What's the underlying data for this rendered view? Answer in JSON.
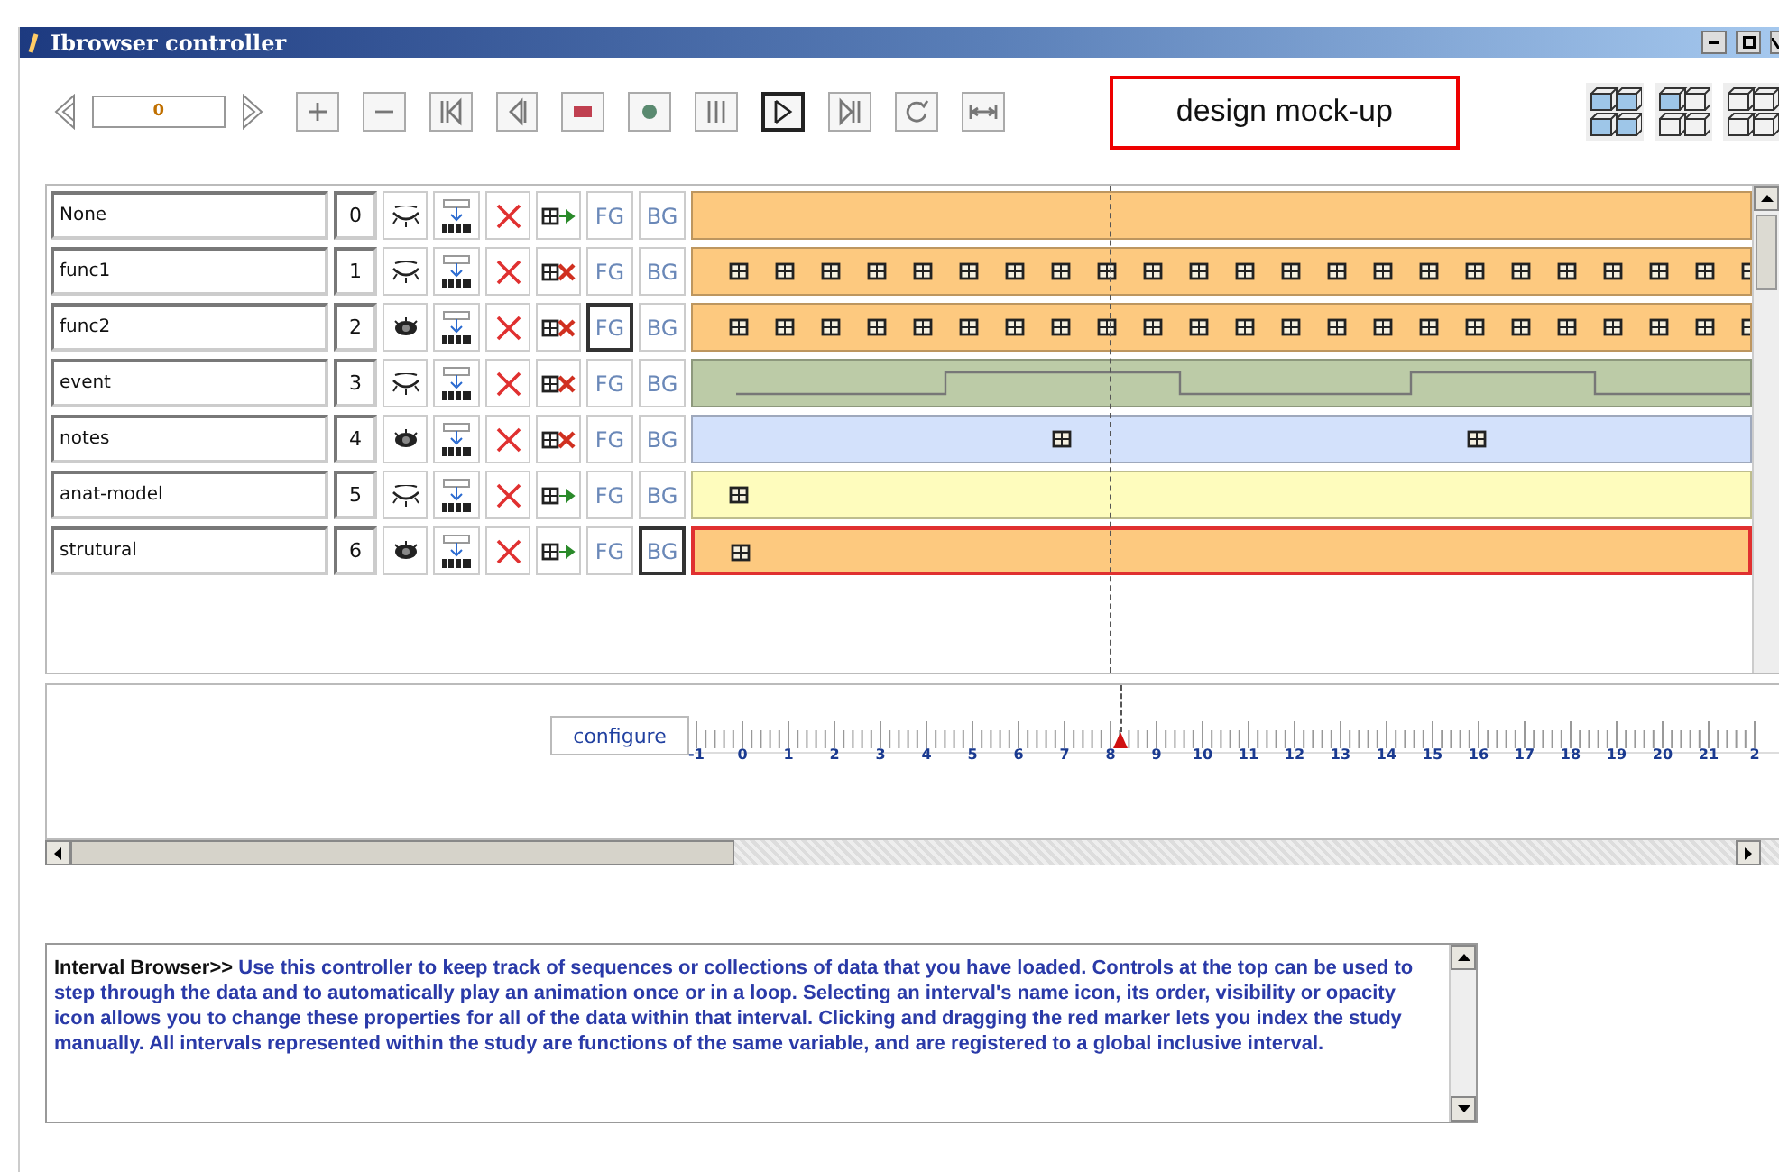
{
  "window": {
    "title": "Ibrowser controller"
  },
  "toolbar": {
    "frame_value": "0",
    "buttons": [
      {
        "kind": "add",
        "selected": false
      },
      {
        "kind": "remove",
        "selected": false
      },
      {
        "kind": "first",
        "selected": false
      },
      {
        "kind": "back",
        "selected": false
      },
      {
        "kind": "stop",
        "selected": false
      },
      {
        "kind": "record",
        "selected": false
      },
      {
        "kind": "pause",
        "selected": false
      },
      {
        "kind": "play",
        "selected": true
      },
      {
        "kind": "last",
        "selected": false
      },
      {
        "kind": "loop",
        "selected": false
      },
      {
        "kind": "fit",
        "selected": false
      }
    ],
    "note": "design mock-up"
  },
  "intervals": [
    {
      "name": "None",
      "order": "0",
      "visible": false,
      "linked": true,
      "fg": "FG",
      "bg": "BG",
      "fg_selected": false,
      "bg_selected": false,
      "color": "#fdc97f",
      "selected": false,
      "kind": "empty"
    },
    {
      "name": "func1",
      "order": "1",
      "visible": false,
      "linked": false,
      "fg": "FG",
      "bg": "BG",
      "fg_selected": false,
      "bg_selected": false,
      "color": "#fdc97f",
      "selected": false,
      "kind": "dense"
    },
    {
      "name": "func2",
      "order": "2",
      "visible": true,
      "linked": false,
      "fg": "FG",
      "bg": "BG",
      "fg_selected": true,
      "bg_selected": false,
      "color": "#fdc97f",
      "selected": false,
      "kind": "dense"
    },
    {
      "name": "event",
      "order": "3",
      "visible": false,
      "linked": false,
      "fg": "FG",
      "bg": "BG",
      "fg_selected": false,
      "bg_selected": false,
      "color": "#bccba7",
      "selected": false,
      "kind": "wave"
    },
    {
      "name": "notes",
      "order": "4",
      "visible": true,
      "linked": false,
      "fg": "FG",
      "bg": "BG",
      "fg_selected": false,
      "bg_selected": false,
      "color": "#d3e1fb",
      "selected": false,
      "kind": "sparse"
    },
    {
      "name": "anat-model",
      "order": "5",
      "visible": false,
      "linked": true,
      "fg": "FG",
      "bg": "BG",
      "fg_selected": false,
      "bg_selected": false,
      "color": "#fefcbd",
      "selected": false,
      "kind": "single"
    },
    {
      "name": "strutural",
      "order": "6",
      "visible": true,
      "linked": true,
      "fg": "FG",
      "bg": "BG",
      "fg_selected": false,
      "bg_selected": true,
      "color": "#fdc97f",
      "selected": true,
      "kind": "single"
    }
  ],
  "timeline": {
    "configure": "configure",
    "cursor": {
      "level": 0.392
    },
    "labels": [
      "-1",
      "0",
      "1",
      "2",
      "3",
      "4",
      "5",
      "6",
      "7",
      "8",
      "9",
      "10",
      "11",
      "12",
      "13",
      "14",
      "15",
      "16",
      "17",
      "18",
      "19",
      "20",
      "21",
      "2"
    ]
  },
  "help": "**Interval Browser>>** Use this controller to keep track of sequences or collections  of data that you have loaded. Controls at the top can be used to step  through the data and to automatically play an animation once or in a loop. Selecting an interval's name icon, its order, visibility or opacity icon allows  you to change these properties for all of the data within that interval.  Clicking and dragging the red marker lets you index the study manually.  All intervals represented within the study are functions of the same  variable, and are registered to a global inclusive interval."
}
